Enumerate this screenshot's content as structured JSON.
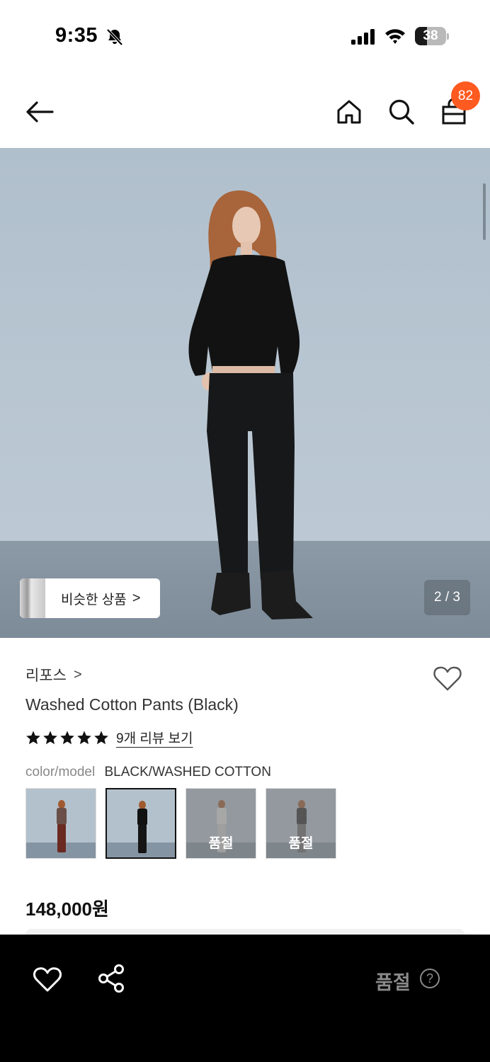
{
  "status_bar": {
    "time": "9:35",
    "battery": "38",
    "battery_level": 0.38
  },
  "header": {
    "cart_count": "82"
  },
  "hero": {
    "similar_label": "비슷한 상품",
    "similar_chevron": ">",
    "page_counter": "2 / 3"
  },
  "product": {
    "brand": "리포스",
    "brand_chevron": ">",
    "name": "Washed Cotton Pants (Black)",
    "rating_stars": 5,
    "review_link": "9개 리뷰 보기",
    "color_label": "color/model",
    "color_value": "BLACK/WASHED COTTON",
    "price": "148,000원"
  },
  "swatches": [
    {
      "top_color": "#6a5048",
      "pants_color": "#6a2a22",
      "selected": false,
      "soldout": false,
      "soldout_label": ""
    },
    {
      "top_color": "#111111",
      "pants_color": "#151515",
      "selected": true,
      "soldout": false,
      "soldout_label": ""
    },
    {
      "top_color": "#e0e0e0",
      "pants_color": "#cfcfcf",
      "selected": false,
      "soldout": true,
      "soldout_label": "품절"
    },
    {
      "top_color": "#2a2a2a",
      "pants_color": "#6a6a6a",
      "selected": false,
      "soldout": true,
      "soldout_label": "품절"
    }
  ],
  "bottom_bar": {
    "soldout_label": "품절",
    "help_glyph": "?"
  },
  "colors": {
    "badge": "#ff5a1f",
    "bottom_bar": "#000000",
    "disabled_text": "#8a8a8a"
  }
}
